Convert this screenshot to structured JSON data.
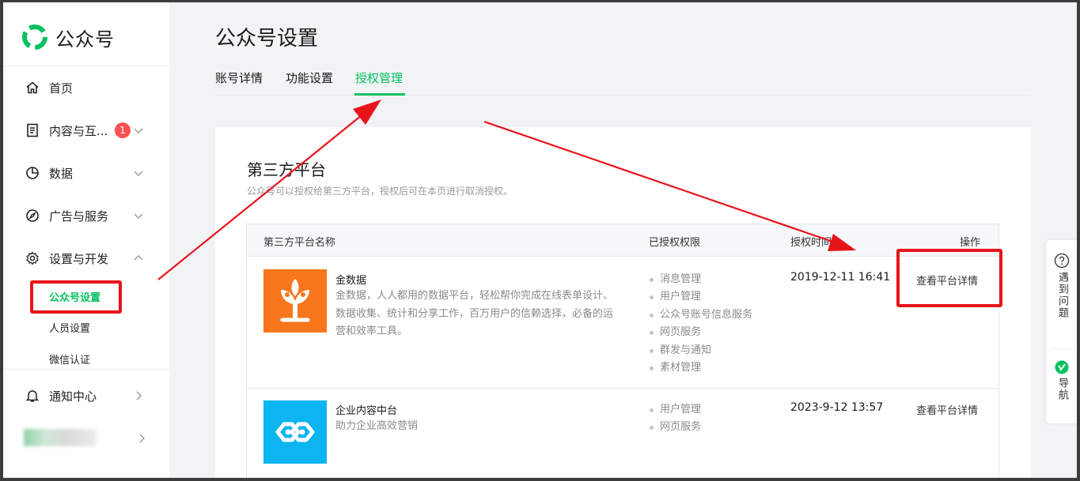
{
  "sidebar": {
    "brand": "公众号",
    "items": [
      {
        "label": "首页"
      },
      {
        "label": "内容与互...",
        "badge": "1"
      },
      {
        "label": "数据"
      },
      {
        "label": "广告与服务"
      },
      {
        "label": "设置与开发"
      }
    ],
    "sub_items": [
      {
        "label": "公众号设置"
      },
      {
        "label": "人员设置"
      },
      {
        "label": "微信认证"
      }
    ],
    "notification": {
      "label": "通知中心"
    }
  },
  "main": {
    "title": "公众号设置",
    "tabs": [
      {
        "label": "账号详情"
      },
      {
        "label": "功能设置"
      },
      {
        "label": "授权管理"
      }
    ],
    "section": {
      "title": "第三方平台",
      "description": "公众号可以授权给第三方平台，授权后可在本页进行取消授权。"
    },
    "table": {
      "headers": {
        "name": "第三方平台名称",
        "permissions": "已授权权限",
        "time": "授权时间",
        "action": "操作"
      },
      "rows": [
        {
          "name": "金数据",
          "description": "金数据，人人都用的数据平台，轻松帮你完成在线表单设计、数据收集、统计和分享工作，百万用户的信赖选择，必备的运营和效率工具。",
          "permissions": [
            "消息管理",
            "用户管理",
            "公众号账号信息服务",
            "网页服务",
            "群发与通知",
            "素材管理"
          ],
          "time": "2019-12-11 16:41",
          "action": "查看平台详情"
        },
        {
          "name": "企业内容中台",
          "description": "助力企业高效营销",
          "permissions": [
            "用户管理",
            "网页服务"
          ],
          "time": "2023-9-12 13:57",
          "action": "查看平台详情"
        }
      ]
    }
  },
  "float_panel": {
    "help": "遇到问题",
    "guide": "导航"
  },
  "colors": {
    "accent": "#07c160",
    "annotation": "#e8141b",
    "badge": "#fa5151",
    "jinshuju_logo": "#f8761c",
    "enterprise_logo": "#0cb5f0"
  }
}
